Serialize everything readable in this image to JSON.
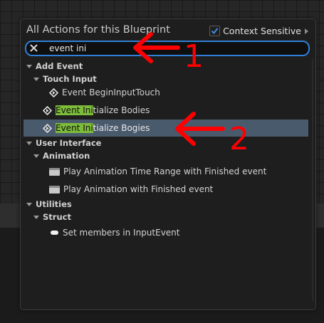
{
  "panel": {
    "title": "All Actions for this Blueprint",
    "context_label": "Context Sensitive",
    "context_checked": true
  },
  "search": {
    "value": "event ini"
  },
  "tree": {
    "add_event": "Add Event",
    "touch_input": "Touch Input",
    "begin_input_touch": "Event BeginInputTouch",
    "init_bodies": {
      "match": "Event Ini",
      "rest": "tialize Bodies"
    },
    "init_bogies": {
      "match": "Event Ini",
      "rest": "tialize Bogies"
    },
    "user_interface": "User Interface",
    "animation": "Animation",
    "play_anim_range": "Play Animation Time Range with Finished event",
    "play_anim": "Play Animation with Finished event",
    "utilities": "Utilities",
    "struct": "Struct",
    "set_members": "Set members in InputEvent"
  },
  "annotations": {
    "label_1": "1",
    "label_2": "2",
    "color": "#ff0000"
  },
  "colors": {
    "search_border": "#2f7fd6",
    "selection": "#4a5a6d",
    "match_highlight": "#7dbb3a"
  }
}
